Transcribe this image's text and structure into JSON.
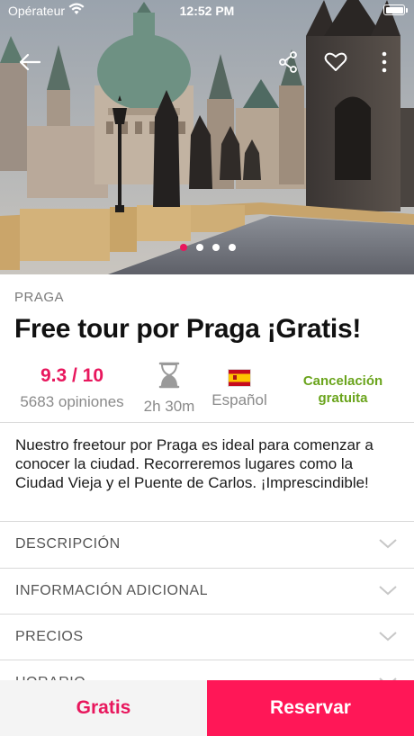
{
  "status_bar": {
    "carrier": "Opérateur",
    "time": "12:52 PM"
  },
  "hero": {
    "image_icon": "prague-charles-bridge-photo",
    "dots_total": 4,
    "dots_active": 0
  },
  "tour": {
    "city": "PRAGA",
    "title": "Free tour por Praga ¡Gratis!",
    "rating": "9.3 / 10",
    "reviews": "5683 opiniones",
    "duration": "2h 30m",
    "language": "Español",
    "cancellation": "Cancelación gratuita",
    "description": "Nuestro freetour por Praga es ideal para comenzar a conocer la ciudad. Recorreremos lugares como la Ciudad Vieja y el Puente de Carlos. ¡Imprescindible!"
  },
  "sections": [
    {
      "label": "DESCRIPCIÓN"
    },
    {
      "label": "INFORMACIÓN ADICIONAL"
    },
    {
      "label": "PRECIOS"
    },
    {
      "label": "HORARIO"
    }
  ],
  "bottom_bar": {
    "price_label": "Gratis",
    "book_label": "Reservar"
  },
  "colors": {
    "accent": "#e8175d",
    "book": "#ff1757",
    "green": "#6aa41c"
  }
}
